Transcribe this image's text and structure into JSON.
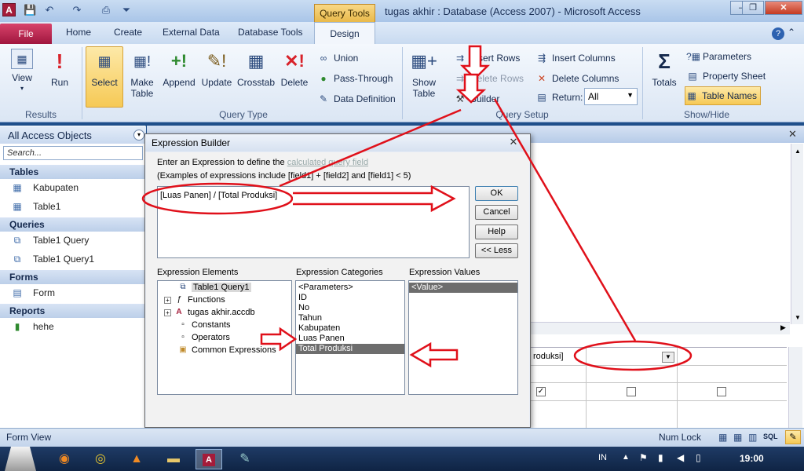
{
  "window": {
    "title": "tugas akhir : Database (Access 2007)  -  Microsoft Access",
    "context_tab": "Query Tools",
    "minimize": "–",
    "restore": "❐",
    "close": "✕"
  },
  "ribbon_tabs": {
    "file": "File",
    "home": "Home",
    "create": "Create",
    "external": "External Data",
    "dbtools": "Database Tools",
    "design": "Design"
  },
  "results_group": {
    "label": "Results",
    "view": "View",
    "run": "Run"
  },
  "query_type_group": {
    "label": "Query Type",
    "select": "Select",
    "make_table_1": "Make",
    "make_table_2": "Table",
    "append": "Append",
    "update": "Update",
    "crosstab": "Crosstab",
    "delete": "Delete",
    "union": "Union",
    "pass_through": "Pass-Through",
    "data_definition": "Data Definition"
  },
  "query_setup_group": {
    "label": "Query Setup",
    "show_table_1": "Show",
    "show_table_2": "Table",
    "insert_rows": "Insert Rows",
    "delete_rows": "Delete Rows",
    "builder": "Builder",
    "insert_columns": "Insert Columns",
    "delete_columns": "Delete Columns",
    "return_label": "Return:",
    "return_value": "All"
  },
  "show_hide_group": {
    "label": "Show/Hide",
    "totals": "Totals",
    "parameters": "Parameters",
    "property_sheet": "Property Sheet",
    "table_names": "Table Names"
  },
  "nav_pane": {
    "header": "All Access Objects",
    "search_placeholder": "Search...",
    "groups": {
      "tables": "Tables",
      "queries": "Queries",
      "forms": "Forms",
      "reports": "Reports"
    },
    "tables": [
      "Kabupaten",
      "Table1"
    ],
    "queries": [
      "Table1 Query",
      "Table1 Query1"
    ],
    "forms": [
      "Form"
    ],
    "reports": [
      "hehe"
    ]
  },
  "dialog": {
    "title": "Expression Builder",
    "instruction_1": "Enter an Expression to define the ",
    "instruction_link": "calculated query field",
    "instruction_2": "(Examples of expressions include [field1] + [field2] and [field1] < 5)",
    "expression": "[Luas Panen] / [Total Produksi]",
    "ok": "OK",
    "cancel": "Cancel",
    "help": "Help",
    "less": "<< Less",
    "elements_label": "Expression Elements",
    "categories_label": "Expression Categories",
    "values_label": "Expression Values",
    "elements": [
      "Table1 Query1",
      "Functions",
      "tugas akhir.accdb",
      "Constants",
      "Operators",
      "Common Expressions"
    ],
    "categories": [
      "<Parameters>",
      "ID",
      "No",
      "Tahun",
      "Kabupaten",
      "Luas Panen",
      "Total Produksi"
    ],
    "values": [
      "<Value>"
    ]
  },
  "grid": {
    "field_text": "roduksi]",
    "checked": "✓"
  },
  "status": {
    "left": "Form View",
    "numlock": "Num Lock"
  },
  "taskbar": {
    "lang": "IN",
    "time": "19:00"
  },
  "colors": {
    "annotation": "#e0101a",
    "file_tab": "#b8224a",
    "selected": "#f6c955"
  }
}
